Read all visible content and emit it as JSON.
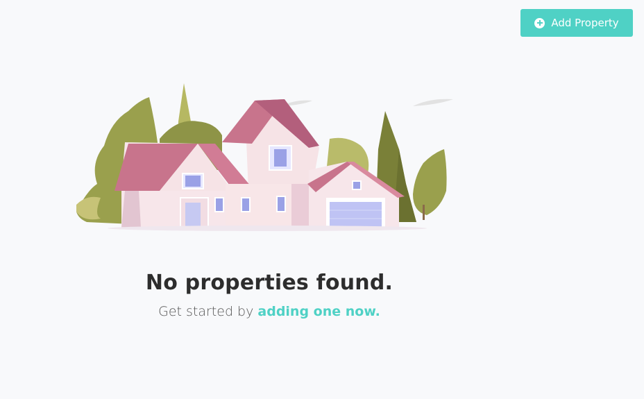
{
  "header": {
    "add_button_label": "Add Property"
  },
  "empty_state": {
    "title": "No properties found.",
    "subtitle_prefix": "Get started by ",
    "subtitle_link": "adding one now."
  },
  "colors": {
    "accent": "#4fd1c5",
    "background": "#f8f9fb",
    "title": "#2d2d2d"
  },
  "icons": {
    "add_button_icon": "plus-circle-icon",
    "illustration": "house-illustration"
  }
}
